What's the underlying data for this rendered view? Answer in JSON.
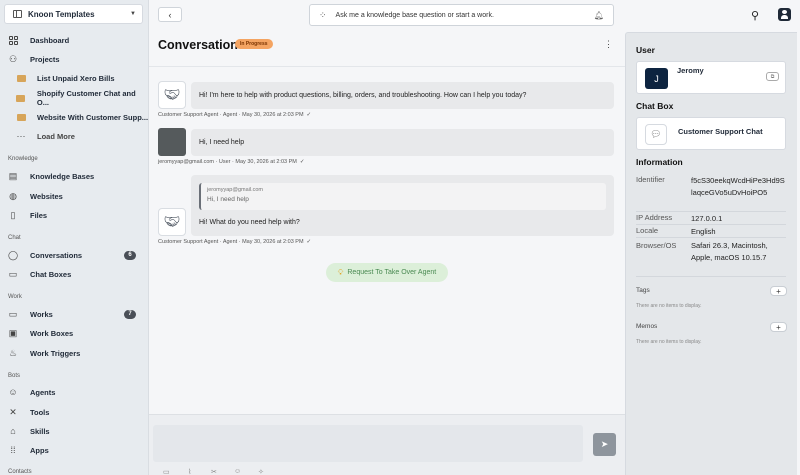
{
  "sidebar": {
    "workspace": "Knoon Templates",
    "top_items": [
      {
        "label": "Dashboard"
      },
      {
        "label": "Projects"
      }
    ],
    "projects": [
      {
        "label": "List Unpaid Xero Bills"
      },
      {
        "label": "Shopify Customer Chat and O..."
      },
      {
        "label": "Website With Customer Supp..."
      }
    ],
    "load_more": "Load More",
    "sections": {
      "knowledge": "Knowledge",
      "chat": "Chat",
      "work": "Work",
      "bots": "Bots",
      "contacts": "Contacts"
    },
    "knowledge_items": [
      {
        "label": "Knowledge Bases"
      },
      {
        "label": "Websites"
      },
      {
        "label": "Files"
      }
    ],
    "chat_items": [
      {
        "label": "Conversations",
        "badge": "6"
      },
      {
        "label": "Chat Boxes"
      }
    ],
    "work_items": [
      {
        "label": "Works",
        "badge": "7"
      },
      {
        "label": "Work Boxes"
      },
      {
        "label": "Work Triggers"
      }
    ],
    "bot_items": [
      {
        "label": "Agents"
      },
      {
        "label": "Tools"
      },
      {
        "label": "Skills"
      },
      {
        "label": "Apps"
      }
    ]
  },
  "topbar": {
    "ask_placeholder": "Ask me a knowledge base question or start a work."
  },
  "conversation": {
    "title": "Conversation",
    "status": "In Progress",
    "messages": [
      {
        "text": "Hi! I'm here to help with product questions, billing, orders, and troubleshooting. How can I help you today?",
        "meta": "Customer Support Agent · Agent · May 30, 2026 at 2:03 PM"
      },
      {
        "text": "Hi, I need help",
        "meta": "jeromyyap@gmail.com · User · May 30, 2026 at 2:03 PM"
      },
      {
        "quote_author": "jeromyyap@gmail.com",
        "quote_text": "Hi, I need help",
        "text": "Hi! What do you need help with?",
        "meta": "Customer Support Agent · Agent · May 30, 2026 at 2:03 PM"
      }
    ],
    "takeover_label": "Request To Take Over Agent"
  },
  "right_panel": {
    "user_heading": "User",
    "user_name": "Jeromy",
    "user_initial": "J",
    "chatbox_heading": "Chat Box",
    "chatbox_name": "Customer Support Chat",
    "info_heading": "Information",
    "info": [
      {
        "key": "Identifier",
        "value": "f5cS30eekqWcdHiPe3Hd9SlaqceGVo5uDvHoiPO5"
      },
      {
        "key": "IP Address",
        "value": "127.0.0.1"
      },
      {
        "key": "Locale",
        "value": "English"
      },
      {
        "key": "Browser/OS",
        "value": "Safari 26.3, Macintosh, Apple, macOS 10.15.7"
      }
    ],
    "tags_heading": "Tags",
    "tags_empty": "There are no items to display.",
    "memos_heading": "Memos",
    "memos_empty": "There are no items to display."
  }
}
